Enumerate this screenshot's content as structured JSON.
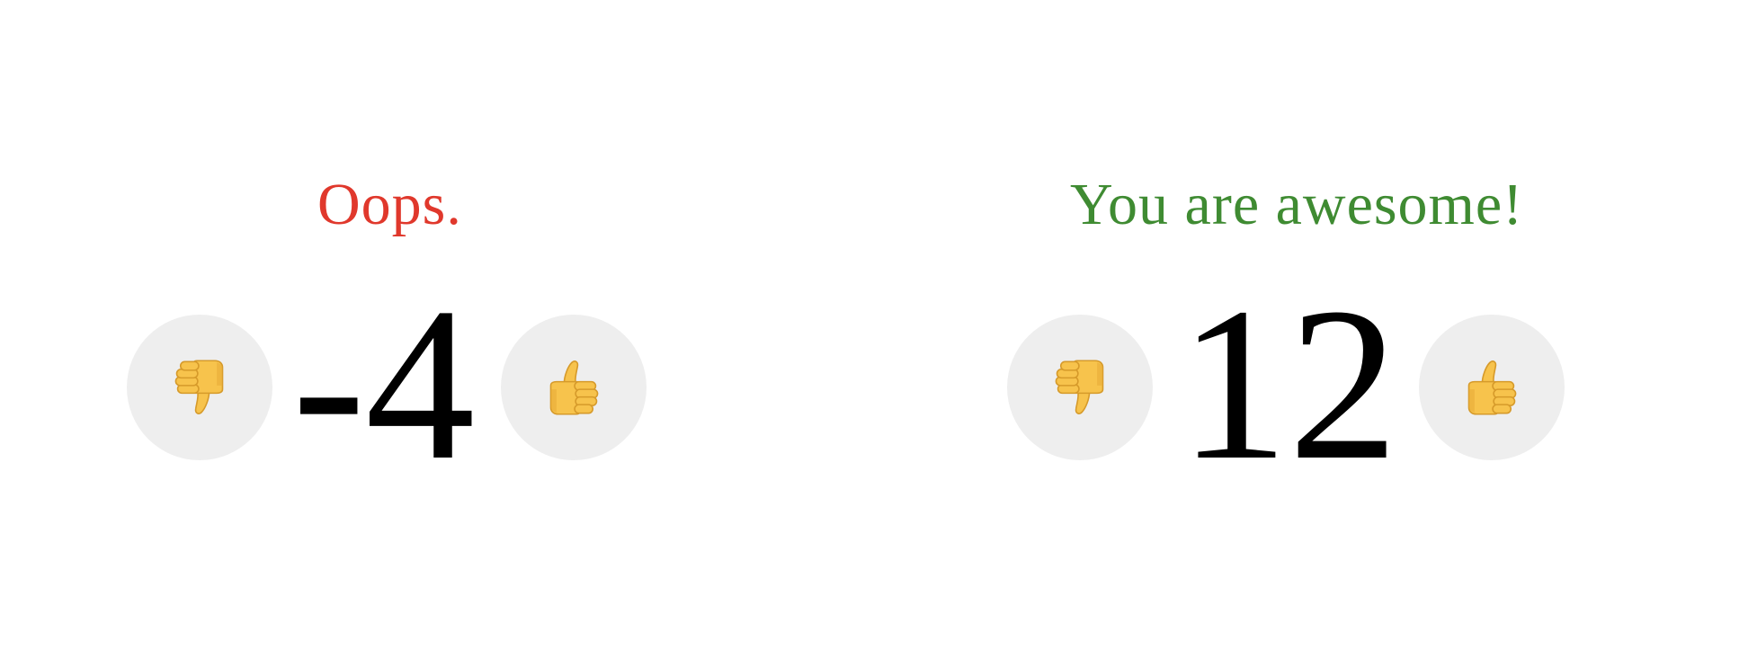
{
  "widgets": [
    {
      "message": "Oops.",
      "message_color": "#e0382c",
      "score": "-4",
      "downvote_icon": "thumbs-down-icon",
      "upvote_icon": "thumbs-up-icon"
    },
    {
      "message": "You are awesome!",
      "message_color": "#3f8b32",
      "score": "12",
      "downvote_icon": "thumbs-down-icon",
      "upvote_icon": "thumbs-up-icon"
    }
  ],
  "colors": {
    "button_bg": "#eeeeee",
    "thumb_fill": "#f7c34c",
    "thumb_outline": "#d69a2a"
  }
}
